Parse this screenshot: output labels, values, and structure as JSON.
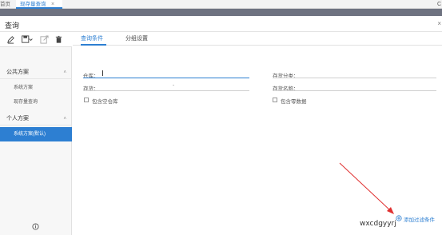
{
  "tabs": {
    "home_label": "首页",
    "active_label": "现存量查询",
    "close_glyph": "×",
    "corner_glyph": "C"
  },
  "dialog": {
    "title": "查询",
    "close_glyph": "×"
  },
  "sidebar": {
    "toolbar_icons": [
      "edit-icon",
      "save-dropdown-icon",
      "export-icon",
      "delete-icon"
    ],
    "public_group": "公共方案",
    "public_items": [
      "系统方案",
      "现存量查询"
    ],
    "personal_group": "个人方案",
    "personal_items": [
      "系统方案(默认)"
    ],
    "chevron": "˄"
  },
  "main": {
    "tabs": [
      "查询条件",
      "分组设置"
    ],
    "fields": {
      "warehouse_label": "仓库：",
      "inventory_label": "存货：",
      "inventory_class_label": "存货分类：",
      "inventory_name_label": "存货名称：",
      "inventory_arrow": "-"
    },
    "checkboxes": {
      "include_empty_warehouse": "包含空仓库",
      "include_zero_data": "包含零数据"
    },
    "add_filter_label": "添加过滤条件",
    "watermark_text": "wxcdgyyrj"
  },
  "colors": {
    "accent": "#2d7fd2",
    "annotation_arrow": "#e03030"
  }
}
